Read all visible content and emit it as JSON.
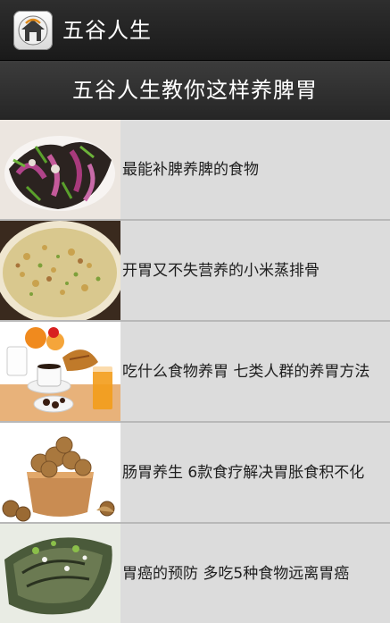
{
  "app": {
    "title": "五谷人生",
    "icon": "home-icon"
  },
  "banner": {
    "title": "五谷人生教你这样养脾胃"
  },
  "articles": [
    {
      "title": "最能补脾养脾的食物",
      "image": "salad-image"
    },
    {
      "title": "开胃又不失营养的小米蒸排骨",
      "image": "millet-rib-image"
    },
    {
      "title": "吃什么食物养胃 七类人群的养胃方法",
      "image": "breakfast-image"
    },
    {
      "title": "肠胃养生 6款食疗解决胃胀食积不化",
      "image": "walnut-image"
    },
    {
      "title": "胃癌的预防 多吃5种食物远离胃癌",
      "image": "fish-image"
    }
  ]
}
